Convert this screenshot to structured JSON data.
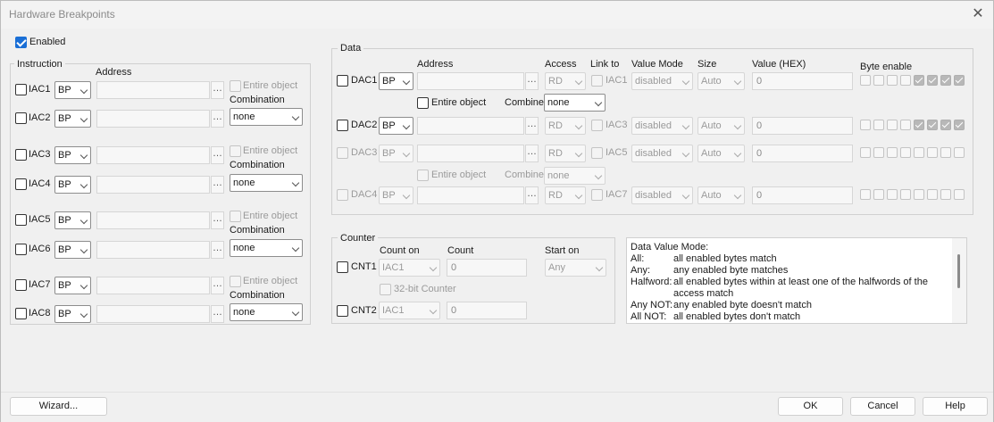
{
  "window": {
    "title": "Hardware Breakpoints"
  },
  "enabled": {
    "label": "Enabled",
    "checked": true
  },
  "instruction": {
    "group_label": "Instruction",
    "address_header": "Address",
    "entire_object_label": "Entire object",
    "combination_label": "Combination",
    "rows": [
      {
        "name": "IAC1",
        "type": "BP",
        "address": ""
      },
      {
        "name": "IAC2",
        "type": "BP",
        "address": "",
        "combination": "none"
      },
      {
        "name": "IAC3",
        "type": "BP",
        "address": ""
      },
      {
        "name": "IAC4",
        "type": "BP",
        "address": "",
        "combination": "none"
      },
      {
        "name": "IAC5",
        "type": "BP",
        "address": ""
      },
      {
        "name": "IAC6",
        "type": "BP",
        "address": "",
        "combination": "none"
      },
      {
        "name": "IAC7",
        "type": "BP",
        "address": ""
      },
      {
        "name": "IAC8",
        "type": "BP",
        "address": "",
        "combination": "none"
      }
    ]
  },
  "data": {
    "group_label": "Data",
    "headers": {
      "address": "Address",
      "access": "Access",
      "link_to": "Link to",
      "value_mode": "Value Mode",
      "size": "Size",
      "value_hex": "Value (HEX)",
      "byte_enable": "Byte enable"
    },
    "entire_object_label": "Entire object",
    "combine_label": "Combine",
    "combine_values": [
      "none",
      "none"
    ],
    "rows": [
      {
        "name": "DAC1",
        "type": "BP",
        "access": "RD",
        "link": "IAC1",
        "value_mode": "disabled",
        "size": "Auto",
        "value": "0",
        "bytes": [
          false,
          false,
          false,
          false,
          true,
          true,
          true,
          true
        ]
      },
      {
        "name": "DAC2",
        "type": "BP",
        "access": "RD",
        "link": "IAC3",
        "value_mode": "disabled",
        "size": "Auto",
        "value": "0",
        "bytes": [
          false,
          false,
          false,
          false,
          true,
          true,
          true,
          true
        ]
      },
      {
        "name": "DAC3",
        "type": "BP",
        "access": "RD",
        "link": "IAC5",
        "value_mode": "disabled",
        "size": "Auto",
        "value": "0",
        "bytes": [
          false,
          false,
          false,
          false,
          false,
          false,
          false,
          false
        ]
      },
      {
        "name": "DAC4",
        "type": "BP",
        "access": "RD",
        "link": "IAC7",
        "value_mode": "disabled",
        "size": "Auto",
        "value": "0",
        "bytes": [
          false,
          false,
          false,
          false,
          false,
          false,
          false,
          false
        ]
      }
    ]
  },
  "counter": {
    "group_label": "Counter",
    "headers": {
      "count_on": "Count on",
      "count": "Count",
      "start_on": "Start on"
    },
    "bit32_label": "32-bit Counter",
    "rows": [
      {
        "name": "CNT1",
        "count_on": "IAC1",
        "count": "0",
        "start_on": "Any"
      },
      {
        "name": "CNT2",
        "count_on": "IAC1",
        "count": "0"
      }
    ]
  },
  "info": {
    "lines": [
      {
        "k": "Data Value Mode:",
        "v": ""
      },
      {
        "k": "All:",
        "v": "all enabled bytes match"
      },
      {
        "k": "Any:",
        "v": "any enabled byte matches"
      },
      {
        "k": "Halfword:",
        "v": "all enabled bytes within at least one of the halfwords of the"
      },
      {
        "k": "",
        "v": "access match"
      },
      {
        "k": "Any NOT:",
        "v": "any enabled byte doesn't match"
      },
      {
        "k": "All NOT:",
        "v": "all enabled bytes don't match"
      }
    ]
  },
  "buttons": {
    "wizard": "Wizard...",
    "ok": "OK",
    "cancel": "Cancel",
    "help": "Help"
  }
}
